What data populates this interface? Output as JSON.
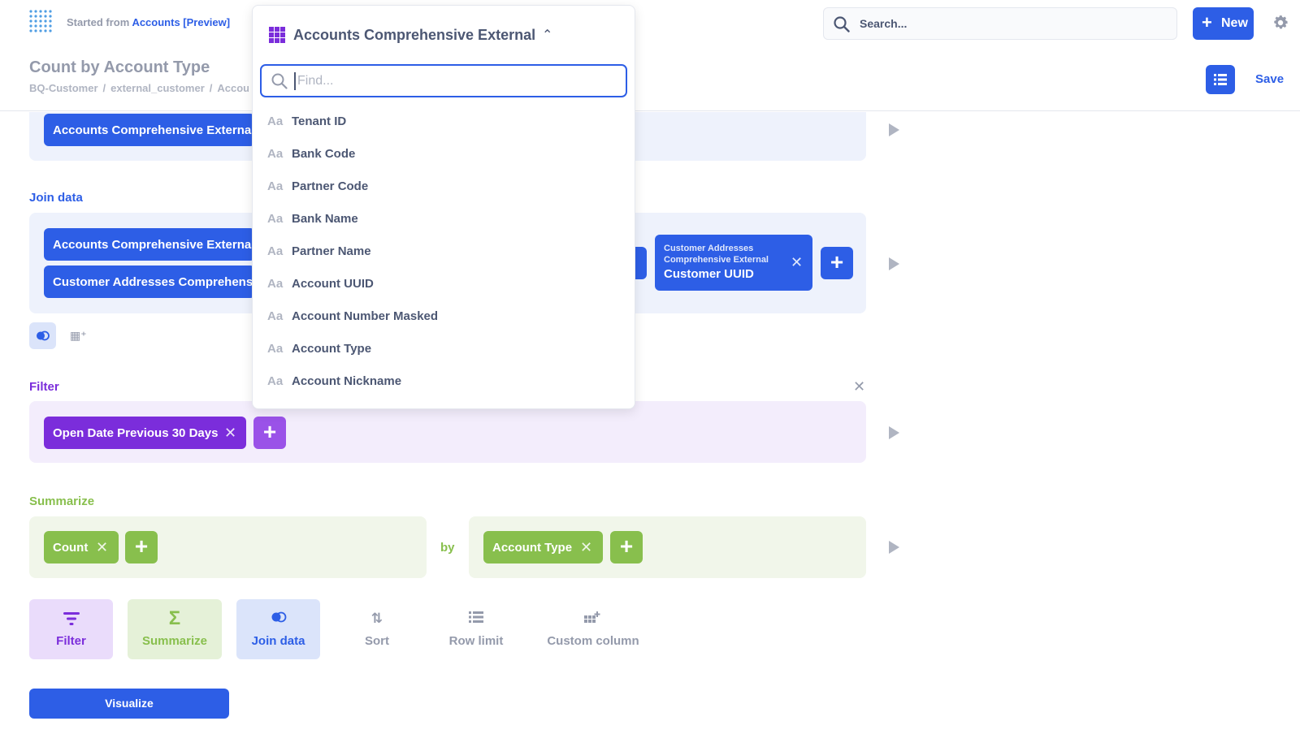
{
  "header": {
    "started_prefix": "Started from",
    "started_link": "Accounts [Preview]",
    "title": "Count by Account Type",
    "breadcrumbs": [
      "BQ-Customer",
      "external_customer",
      "Accou"
    ],
    "search_placeholder": "Search...",
    "new_label": "New",
    "save_label": "Save"
  },
  "data_section": {
    "table_pill": "Accounts Comprehensive External"
  },
  "join_section": {
    "title": "Join data",
    "left_pills": [
      "Accounts Comprehensive External",
      "Customer Addresses Comprehensi"
    ],
    "right_pill": {
      "subtitle_1": "Customer Addresses",
      "subtitle_2": "Comprehensive External",
      "column": "Customer UUID"
    }
  },
  "filter_section": {
    "title": "Filter",
    "pill": "Open Date Previous 30 Days"
  },
  "summarize_section": {
    "title": "Summarize",
    "metric": "Count",
    "by_label": "by",
    "breakout": "Account Type"
  },
  "actions": {
    "filter": "Filter",
    "summarize": "Summarize",
    "join": "Join data",
    "sort": "Sort",
    "row_limit": "Row limit",
    "custom_column": "Custom column",
    "visualize": "Visualize"
  },
  "popover": {
    "table_name": "Accounts Comprehensive External",
    "find_placeholder": "Find...",
    "type_glyph": "Aa",
    "options": [
      "Tenant ID",
      "Bank Code",
      "Partner Code",
      "Bank Name",
      "Partner Name",
      "Account UUID",
      "Account Number Masked",
      "Account Type",
      "Account Nickname"
    ]
  },
  "colors": {
    "brand": "#2d5ee6",
    "filter": "#7b2ddb",
    "summarize": "#88bf4d",
    "text": "#4c5773"
  }
}
